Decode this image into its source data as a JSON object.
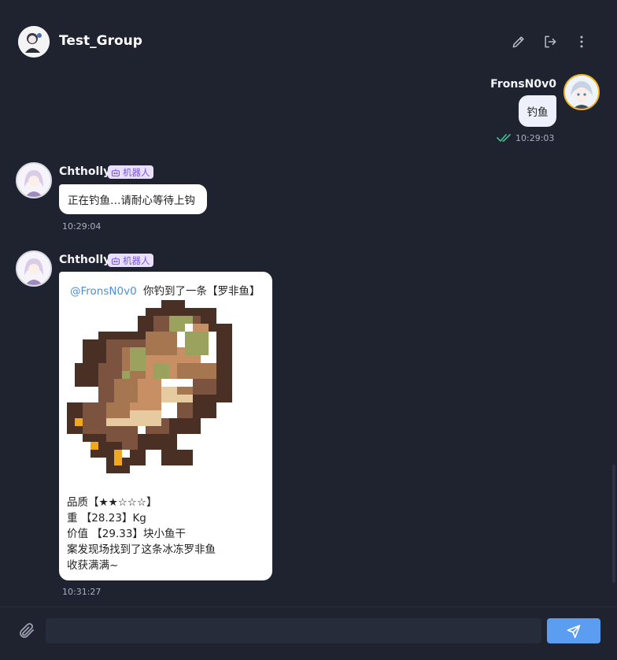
{
  "header": {
    "title": "Test_Group",
    "actions": [
      "edit-icon",
      "leave-icon",
      "more-icon"
    ]
  },
  "messages": [
    {
      "sender": "FronsN0v0",
      "text": "钓鱼",
      "time": "10:29:03",
      "status": "read"
    },
    {
      "sender": "Chtholly",
      "badge": "机器人",
      "text": "正在钓鱼…请耐心等待上钩",
      "time": "10:29:04"
    },
    {
      "sender": "Chtholly",
      "badge": "机器人",
      "mention": "@FronsN0v0",
      "headline": "你钓到了一条【罗非鱼】",
      "details": [
        "品质【★★☆☆☆】",
        "重 【28.23】Kg",
        "价值 【29.33】块小鱼干",
        "案发现场找到了这条冰冻罗非鱼",
        "收获满满~"
      ],
      "time": "10:31:27"
    }
  ],
  "composer": {
    "placeholder": "",
    "attach_icon": "paperclip-icon",
    "send_icon": "send-icon"
  },
  "colors": {
    "background": "#1f2330",
    "accent": "#5b9df0",
    "mention": "#4d8fd6",
    "badge_bg": "#e9e0ff",
    "badge_fg": "#7a57d1",
    "read_check": "#3fbf8f"
  }
}
